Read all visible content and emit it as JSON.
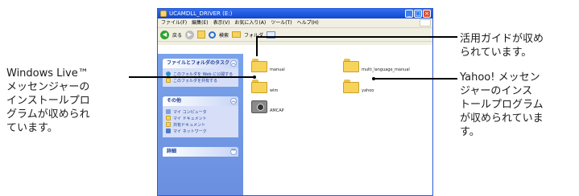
{
  "window": {
    "title": "UCAMDLL_DRIVER (E:)",
    "menu": [
      "ファイル(F)",
      "編集(E)",
      "表示(V)",
      "お気に入り(A)",
      "ツール(T)",
      "ヘルプ(H)"
    ],
    "toolbar": {
      "back_label": "戻る",
      "search_label": "検索",
      "folders_label": "フォルダ"
    }
  },
  "task_pane": {
    "file_tasks": {
      "title": "ファイルとフォルダのタスク",
      "items": [
        "このフォルダを Web に公開する",
        "このフォルダを共有する"
      ]
    },
    "other_places": {
      "title": "その他",
      "items": [
        "マイ コンピュータ",
        "マイ ドキュメント",
        "共有ドキュメント",
        "マイ ネットワーク"
      ]
    },
    "details": {
      "title": "詳細"
    }
  },
  "files": [
    {
      "name": "manual",
      "type": "folder"
    },
    {
      "name": "multi_language_manual",
      "type": "folder"
    },
    {
      "name": "wlm",
      "type": "folder"
    },
    {
      "name": "yahoo",
      "type": "folder"
    },
    {
      "name": "AMCAP",
      "type": "application"
    }
  ],
  "callouts": {
    "manual": "活用ガイドが収め\nられています。",
    "wlm": "Windows Live™\nメッセンジャーの\nインストールプロ\nグラムが収められ\nています。",
    "yahoo": "Yahoo! メッセン\nジャーのインス\nトールプログラム\nが収められていま\nす。"
  }
}
